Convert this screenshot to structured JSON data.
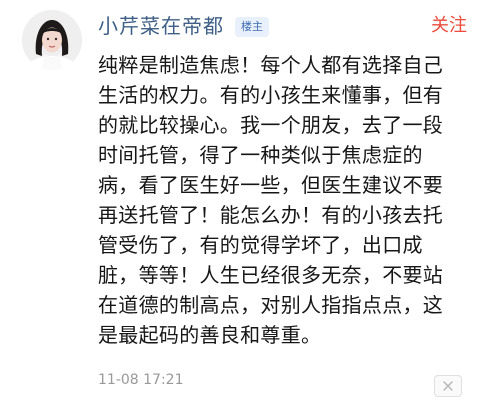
{
  "post": {
    "author": {
      "name": "小芹菜在帝都",
      "badge": "楼主",
      "avatar_icon": "avatar-woman-photo"
    },
    "follow_label": "关注",
    "content_lines": [
      "纯粹是制造焦虑！每个人都有选择自己",
      "生活的权力。有的小孩生来懂事，但有",
      "的就比较操心。我一个朋友，去了一段",
      "时间托管，得了一种类似于焦虑症的",
      "病，看了医生好一些，但医生建议不要",
      "再送托管了！能怎么办！有的小孩去托",
      "管受伤了，有的觉得学坏了，出口成",
      "脏，等等！人生已经很多无奈，不要站",
      "在道德的制高点，对别人指指点点，这",
      "是最起码的善良和尊重。"
    ],
    "timestamp": "11-08 17:21",
    "close_icon": "close-icon"
  },
  "colors": {
    "username": "#3f5f86",
    "follow": "#ee4b3b",
    "badge_bg": "#e8f0fb",
    "badge_text": "#3f6db4",
    "body_text": "#161616",
    "timestamp": "#999999"
  }
}
